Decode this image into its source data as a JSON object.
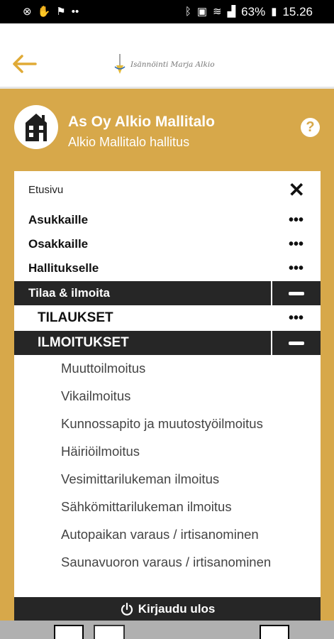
{
  "status_bar": {
    "battery": "63%",
    "time": "15.26"
  },
  "header": {
    "title": "As Oy Alkio Mallitalo",
    "subtitle": "Alkio Mallitalo hallitus",
    "help_label": "?",
    "logo_text": "Isännöinti Marja Alkio"
  },
  "menu": {
    "home": "Etusivu",
    "close_label": "✕",
    "items": [
      {
        "label": "Asukkaille",
        "more": "•••"
      },
      {
        "label": "Osakkaille",
        "more": "•••"
      },
      {
        "label": "Hallitukselle",
        "more": "•••"
      }
    ],
    "expanded": {
      "label": "Tilaa & ilmoita"
    },
    "sub_sections": [
      {
        "label": "TILAUKSET",
        "more": "•••"
      },
      {
        "label": "ILMOITUKSET"
      }
    ],
    "notifications": [
      "Muuttoilmoitus",
      "Vikailmoitus",
      "Kunnossapito ja muutostyöilmoitus",
      "Häiriöilmoitus",
      "Vesimittarilukeman ilmoitus",
      "Sähkömittarilukeman ilmoitus",
      "Autopaikan varaus / irtisanominen",
      "Saunavuoron varaus / irtisanominen"
    ]
  },
  "logout_label": "Kirjaudu ulos",
  "colors": {
    "accent": "#d7a84a",
    "dark": "#262626"
  }
}
